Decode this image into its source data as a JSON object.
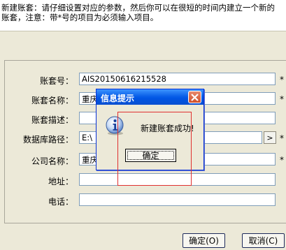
{
  "intro": {
    "text": "新建账套：请仔细设置对应的参数，然后你可以在很短的时间内建立一个新的\n账套，注意：带*号的项目为必须输入项目。"
  },
  "form": {
    "required_mark": "*",
    "browse_label": ">",
    "fields": [
      {
        "label": "账套号：",
        "value": "AIS20150616215528"
      },
      {
        "label": "账套名称：",
        "value": "重庆"
      },
      {
        "label": "账套描述：",
        "value": ""
      },
      {
        "label": "数据库路径：",
        "value": "E:\\"
      },
      {
        "label": "公司名称：",
        "value": "重庆"
      },
      {
        "label": "地址：",
        "value": ""
      },
      {
        "label": "电话：",
        "value": ""
      }
    ]
  },
  "buttons": {
    "ok": "确定(O)",
    "cancel": "取消(C)"
  },
  "dialog": {
    "title": "信息提示",
    "message": "新建账套成功!",
    "ok": "确定",
    "icon": "info-icon"
  },
  "colors": {
    "accent": "#0054e3",
    "highlight": "#e03030",
    "background": "#ece9d8"
  }
}
